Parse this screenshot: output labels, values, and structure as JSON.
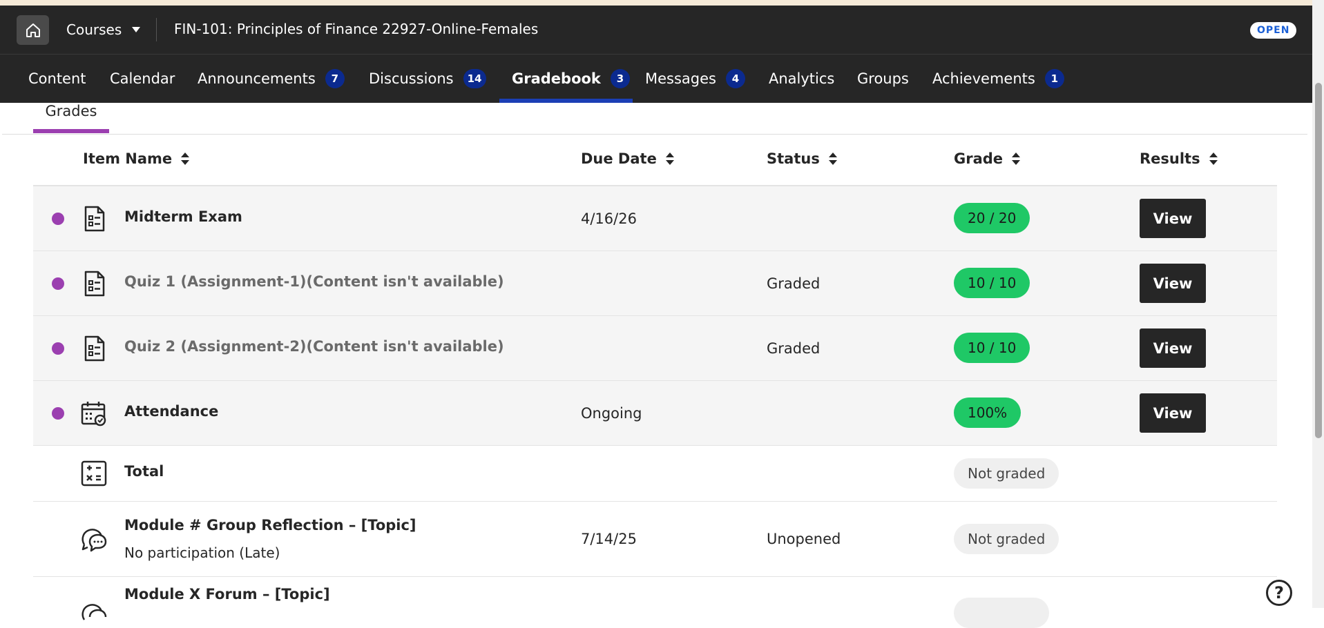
{
  "header": {
    "courses_label": "Courses",
    "course_title": "FIN-101: Principles of Finance 22927-Online-Females",
    "open_badge": "OPEN"
  },
  "nav": {
    "tabs": [
      {
        "label": "Content",
        "count": null
      },
      {
        "label": "Calendar",
        "count": null
      },
      {
        "label": "Announcements",
        "count": "7"
      },
      {
        "label": "Discussions",
        "count": "14"
      },
      {
        "label": "Gradebook",
        "count": "3",
        "active": true
      },
      {
        "label": "Messages",
        "count": "4"
      },
      {
        "label": "Analytics",
        "count": null
      },
      {
        "label": "Groups",
        "count": null
      },
      {
        "label": "Achievements",
        "count": "1"
      }
    ]
  },
  "subtab": {
    "label": "Grades"
  },
  "table": {
    "headers": {
      "item_name": "Item Name",
      "due_date": "Due Date",
      "status": "Status",
      "grade": "Grade",
      "results": "Results"
    },
    "rows": [
      {
        "name": "Midterm Exam",
        "sub": "",
        "due": "4/16/26",
        "status": "",
        "grade": "20 / 20",
        "result": "View"
      },
      {
        "name": "Quiz 1 (Assignment-1)(Content isn't available)",
        "sub": "",
        "due": "",
        "status": "Graded",
        "grade": "10 / 10",
        "result": "View"
      },
      {
        "name": "Quiz 2 (Assignment-2)(Content isn't available)",
        "sub": "",
        "due": "",
        "status": "Graded",
        "grade": "10 / 10",
        "result": "View"
      },
      {
        "name": "Attendance",
        "sub": "",
        "due": "Ongoing",
        "status": "",
        "grade": "100%",
        "result": "View"
      },
      {
        "name": "Total",
        "sub": "",
        "due": "",
        "status": "",
        "grade": "Not graded",
        "result": ""
      },
      {
        "name": "Module # Group Reflection – [Topic]",
        "sub": "No participation (Late)",
        "due": "7/14/25",
        "status": "Unopened",
        "grade": "Not graded",
        "result": ""
      },
      {
        "name": "Module X Forum – [Topic]",
        "sub": "",
        "due": "",
        "status": "",
        "grade": "",
        "result": ""
      }
    ]
  },
  "help": {
    "label": "?"
  },
  "colors": {
    "header_bg": "#262626",
    "accent_purple": "#9b3fb0",
    "badge_navy": "#0b2a8f",
    "grade_green": "#1fc866"
  }
}
